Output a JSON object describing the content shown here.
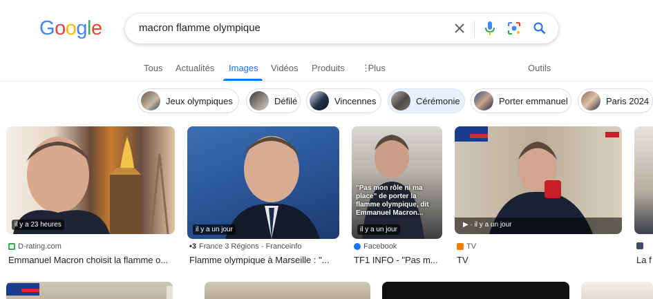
{
  "logo": {
    "letters": [
      "G",
      "o",
      "o",
      "g",
      "l",
      "e"
    ],
    "colors": [
      "#4285F4",
      "#EA4335",
      "#FBBC05",
      "#4285F4",
      "#34A853",
      "#EA4335"
    ]
  },
  "search": {
    "query": "macron flamme olympique",
    "clear_icon": "close-icon",
    "voice_icon": "mic-icon",
    "lens_icon": "lens-icon",
    "search_icon": "search-icon"
  },
  "tabs": [
    {
      "label": "Tous"
    },
    {
      "label": "Actualités"
    },
    {
      "label": "Images",
      "active": true
    },
    {
      "label": "Vidéos"
    },
    {
      "label": "Produits"
    },
    {
      "label": "Plus"
    }
  ],
  "tools_label": "Outils",
  "chips": [
    {
      "label": "Jeux olympiques"
    },
    {
      "label": "Défilé"
    },
    {
      "label": "Vincennes"
    },
    {
      "label": "Cérémonie",
      "selected": true
    },
    {
      "label": "Porter emmanuel"
    },
    {
      "label": "Paris 2024"
    }
  ],
  "results": [
    {
      "time": "il y a 23 heures",
      "source": "D-rating.com",
      "title": "Emmanuel Macron choisit la flamme o..."
    },
    {
      "time": "il y a un jour",
      "source": "France 3 Régions - Franceinfo",
      "title": "Flamme olympique à Marseille : \"..."
    },
    {
      "time": "il y a un jour",
      "source": "Facebook",
      "title": "TF1 INFO - \"Pas m...",
      "overlay": "\"Pas mon rôle ni ma place\" de porter la flamme olympique, dit Emmanuel Macron..."
    },
    {
      "time": "il y a un jour",
      "source": "TV",
      "title": "TV"
    },
    {
      "source": "",
      "title": "La f"
    }
  ],
  "colors": {
    "accent": "#1a73e8",
    "chip_selected": "#e8f0fe"
  }
}
